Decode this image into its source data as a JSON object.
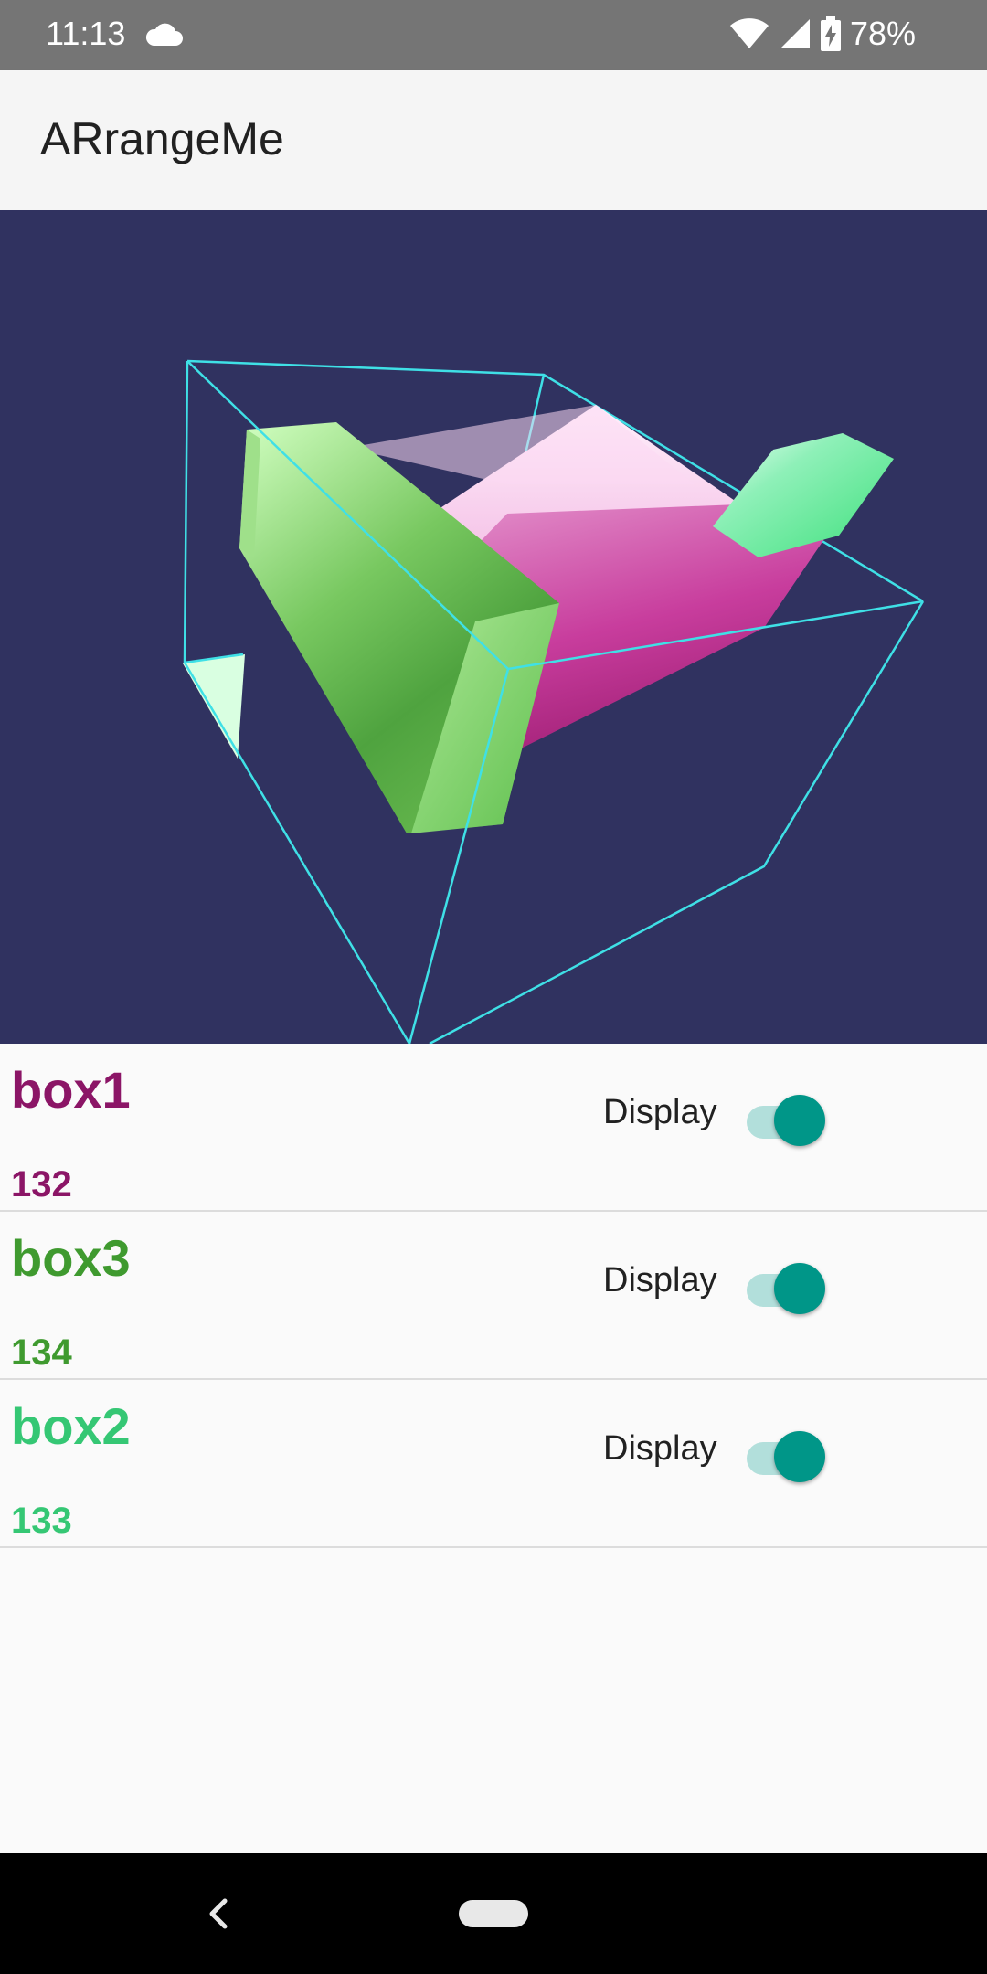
{
  "status_bar": {
    "time": "11:13",
    "battery": "78%"
  },
  "app_bar": {
    "title": "ARrangeMe"
  },
  "icons": {
    "cloud": "cloud-icon",
    "wifi": "wifi-icon",
    "signal": "signal-icon",
    "battery": "battery-charging-icon",
    "back": "back-icon",
    "home": "home-pill-icon"
  },
  "items": [
    {
      "name": "box1",
      "id": "132",
      "display_label": "Display",
      "display_on": true,
      "color": "#8b1566"
    },
    {
      "name": "box3",
      "id": "134",
      "display_label": "Display",
      "display_on": true,
      "color": "#3f9a2f"
    },
    {
      "name": "box2",
      "id": "133",
      "display_label": "Display",
      "display_on": true,
      "color": "#35c774"
    }
  ],
  "colors": {
    "status_bar": "#757575",
    "viewport_bg": "#303260",
    "wireframe": "#3fe0e6",
    "toggle_thumb": "#009688",
    "toggle_track": "#b2dfdb"
  }
}
